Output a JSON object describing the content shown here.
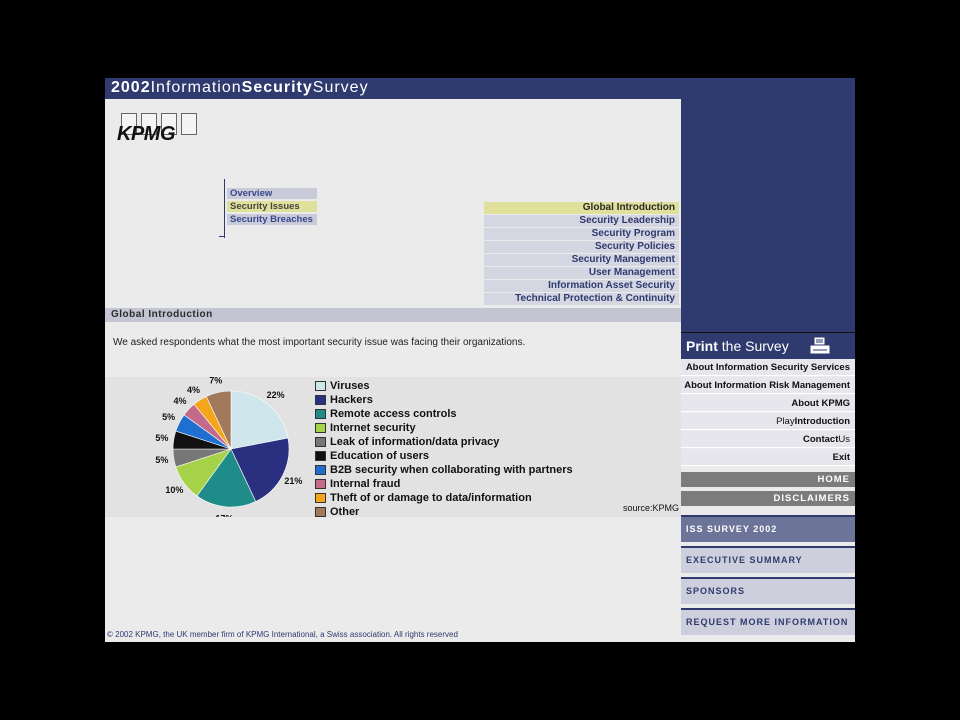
{
  "header": {
    "title_parts": [
      "2002",
      "Information",
      "Security",
      "Survey"
    ]
  },
  "logo": {
    "text": "KPMG"
  },
  "top_nav": {
    "items": [
      {
        "label": "Global Introduction",
        "active": true
      },
      {
        "label": "Security Leadership",
        "active": false
      },
      {
        "label": "Security Program",
        "active": false
      },
      {
        "label": "Security Policies",
        "active": false
      },
      {
        "label": "Security Management",
        "active": false
      },
      {
        "label": "User Management",
        "active": false
      },
      {
        "label": "Information Asset Security",
        "active": false
      },
      {
        "label": "Technical Protection & Continuity",
        "active": false
      }
    ]
  },
  "sub_nav": {
    "items": [
      {
        "label": "Overview",
        "active": false
      },
      {
        "label": "Security Issues",
        "active": true
      },
      {
        "label": "Security Breaches",
        "active": false
      }
    ]
  },
  "section": {
    "title": "Global Introduction"
  },
  "intro": {
    "text": "We asked respondents what the most important security issue was facing their organizations."
  },
  "chart_data": {
    "type": "pie",
    "categories": [
      "Viruses",
      "Hackers",
      "Remote access controls",
      "Internet security",
      "Leak of information/data privacy",
      "Education of users",
      "B2B security when collaborating with partners",
      "Internal fraud",
      "Theft of or damage to data/information",
      "Other"
    ],
    "values": [
      22,
      21,
      17,
      10,
      5,
      5,
      5,
      4,
      4,
      7
    ],
    "labels": [
      "22%",
      "21%",
      "17%",
      "10%",
      "5%",
      "5%",
      "5%",
      "4%",
      "4%",
      "7%"
    ],
    "colors": [
      "#cfe6ec",
      "#2b2f80",
      "#1f8c8a",
      "#a6d24a",
      "#777777",
      "#111111",
      "#1f6fd0",
      "#c46a8a",
      "#f4a51a",
      "#a07a5a"
    ],
    "legend": "right",
    "source": "source:KPMG"
  },
  "footer": {
    "text": "© 2002 KPMG, the UK member firm of KPMG International, a Swiss association. All rights reserved"
  },
  "sidebar": {
    "print": {
      "bold": "Print",
      "rest": " the Survey"
    },
    "links": [
      {
        "bold": "About Information Security Services",
        "light": ""
      },
      {
        "bold": "About Information Risk Management",
        "light": ""
      },
      {
        "bold": "About KPMG",
        "light": ""
      },
      {
        "light": "Play",
        "bold": "Introduction"
      },
      {
        "bold": "Contact",
        "light": "Us"
      },
      {
        "bold": "Exit",
        "light": ""
      }
    ],
    "dark_links": [
      "HOME",
      "DISCLAIMERS"
    ],
    "blocks": [
      {
        "label": "ISS SURVEY 2002",
        "active": true
      },
      {
        "label": "EXECUTIVE SUMMARY",
        "active": false
      },
      {
        "label": "SPONSORS",
        "active": false
      },
      {
        "label": "REQUEST MORE INFORMATION",
        "active": false
      }
    ]
  }
}
